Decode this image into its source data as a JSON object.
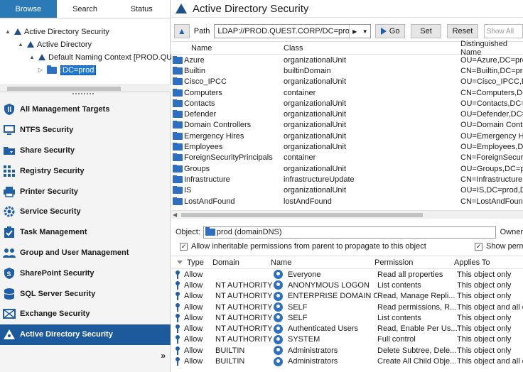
{
  "left_tabs": [
    {
      "label": "Browse"
    },
    {
      "label": "Search"
    },
    {
      "label": "Status"
    }
  ],
  "tree": [
    {
      "label": "Active Directory Security",
      "glyph": "▲"
    },
    {
      "label": "Active Directory",
      "glyph": "▲"
    },
    {
      "label": "Default Naming Context [PROD.QU",
      "glyph": "▲"
    },
    {
      "label": "DC=prod",
      "glyph": "▷"
    }
  ],
  "nav": [
    {
      "label": "All Management Targets",
      "icon": "shield-icon"
    },
    {
      "label": "NTFS Security",
      "icon": "monitor-icon"
    },
    {
      "label": "Share Security",
      "icon": "share-icon"
    },
    {
      "label": "Registry Security",
      "icon": "registry-icon"
    },
    {
      "label": "Printer Security",
      "icon": "printer-icon"
    },
    {
      "label": "Service Security",
      "icon": "gear-icon"
    },
    {
      "label": "Task Management",
      "icon": "task-icon"
    },
    {
      "label": "Group and User Management",
      "icon": "users-icon"
    },
    {
      "label": "SharePoint Security",
      "icon": "sharepoint-icon"
    },
    {
      "label": "SQL Server Security",
      "icon": "database-icon"
    },
    {
      "label": "Exchange Security",
      "icon": "envelope-icon"
    },
    {
      "label": "Active Directory Security",
      "icon": "triangle-icon"
    }
  ],
  "collapse_label": "»",
  "header": {
    "title": "Active Directory Security"
  },
  "pathbar": {
    "label": "Path",
    "value": "LDAP://PROD.QUEST.CORP/DC=prod,DC=",
    "go_label": "Go",
    "set_label": "Set",
    "reset_label": "Reset",
    "show_all_placeholder": "Show All"
  },
  "objects": {
    "headers": {
      "name": "Name",
      "class": "Class",
      "dn": "Distinguished Name"
    },
    "rows": [
      {
        "name": "Azure",
        "class": "organizationalUnit",
        "dn": "OU=Azure,DC=prod"
      },
      {
        "name": "Builtin",
        "class": "builtinDomain",
        "dn": "CN=Builtin,DC=prod"
      },
      {
        "name": "Cisco_IPCC",
        "class": "organizationalUnit",
        "dn": "OU=Cisco_IPCC,DC"
      },
      {
        "name": "Computers",
        "class": "container",
        "dn": "CN=Computers,DC="
      },
      {
        "name": "Contacts",
        "class": "organizationalUnit",
        "dn": "OU=Contacts,DC=p"
      },
      {
        "name": "Defender",
        "class": "organizationalUnit",
        "dn": "OU=Defender,DC=p"
      },
      {
        "name": "Domain Controllers",
        "class": "organizationalUnit",
        "dn": "OU=Domain Contro"
      },
      {
        "name": "Emergency Hires",
        "class": "organizationalUnit",
        "dn": "OU=Emergency Hir"
      },
      {
        "name": "Employees",
        "class": "organizationalUnit",
        "dn": "OU=Employees,DC"
      },
      {
        "name": "ForeignSecurityPrincipals",
        "class": "container",
        "dn": "CN=ForeignSecurit"
      },
      {
        "name": "Groups",
        "class": "organizationalUnit",
        "dn": "OU=Groups,DC=pro"
      },
      {
        "name": "Infrastructure",
        "class": "infrastructureUpdate",
        "dn": "CN=Infrastructure"
      },
      {
        "name": "IS",
        "class": "organizationalUnit",
        "dn": "OU=IS,DC=prod,DC"
      },
      {
        "name": "LostAndFound",
        "class": "lostAndFound",
        "dn": "CN=LostAndFound"
      }
    ]
  },
  "object_line": {
    "label": "Object:",
    "value": "prod (domainDNS)",
    "owner_label": "Owner"
  },
  "inherit": {
    "label": "Allow inheritable permissions from parent to propagate to this object",
    "show_perm_label": "Show perm"
  },
  "perms": {
    "headers": {
      "type": "Type",
      "domain": "Domain",
      "name": "Name",
      "permission": "Permission",
      "applies": "Applies To"
    },
    "rows": [
      {
        "type": "Allow",
        "domain": "",
        "name": "Everyone",
        "permission": "Read all properties",
        "applies": "This object only"
      },
      {
        "type": "Allow",
        "domain": "NT AUTHORITY",
        "name": "ANONYMOUS LOGON",
        "permission": "List contents",
        "applies": "This object only"
      },
      {
        "type": "Allow",
        "domain": "NT AUTHORITY",
        "name": "ENTERPRISE DOMAIN C...",
        "permission": "Read, Manage Repli...",
        "applies": "This object only"
      },
      {
        "type": "Allow",
        "domain": "NT AUTHORITY",
        "name": "SELF",
        "permission": "Read permissions, R...",
        "applies": "This object and all de"
      },
      {
        "type": "Allow",
        "domain": "NT AUTHORITY",
        "name": "SELF",
        "permission": "List contents",
        "applies": "This object only"
      },
      {
        "type": "Allow",
        "domain": "NT AUTHORITY",
        "name": "Authenticated Users",
        "permission": "Read, Enable Per Us...",
        "applies": "This object only"
      },
      {
        "type": "Allow",
        "domain": "NT AUTHORITY",
        "name": "SYSTEM",
        "permission": "Full control",
        "applies": "This object only"
      },
      {
        "type": "Allow",
        "domain": "BUILTIN",
        "name": "Administrators",
        "permission": "Delete Subtree, Dele...",
        "applies": "This object only"
      },
      {
        "type": "Allow",
        "domain": "BUILTIN",
        "name": "Administrators",
        "permission": "Create All Child Obje...",
        "applies": "This object and all de"
      }
    ]
  },
  "colors": {
    "accent": "#2c7ab5",
    "nav_active": "#1c5a9c",
    "icon_blue": "#1f5ea8",
    "folder": "#2e6fc2"
  }
}
